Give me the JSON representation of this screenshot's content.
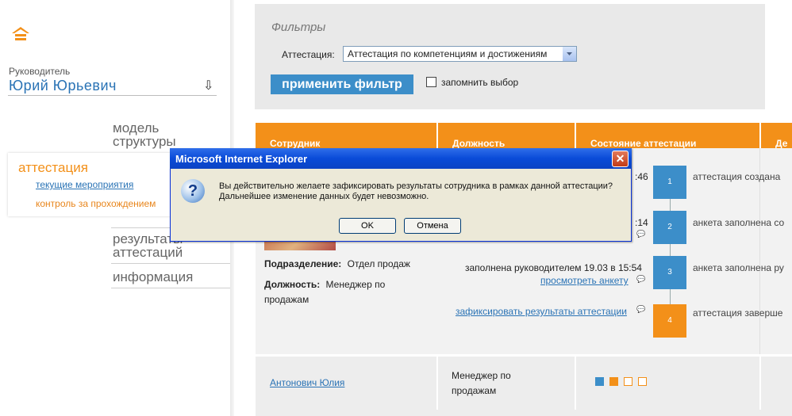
{
  "sidebar": {
    "role": "Руководитель",
    "user": "Юрий  Юрьевич",
    "nav": {
      "model_line1": "модель",
      "model_line2": "структуры",
      "attestation": "аттестация",
      "current_events": "текущие мероприятия",
      "progress_control": "контроль за прохождением",
      "results_line1": "результаты",
      "results_line2": "аттестаций",
      "info": "информация"
    }
  },
  "filters": {
    "title": "Фильтры",
    "attestation_label": "Аттестация:",
    "attestation_value": "Аттестация по компетенциям и достижениям",
    "apply_label": "применить фильтр",
    "remember_label": "запомнить выбор"
  },
  "table": {
    "headers": [
      "Сотрудник",
      "Должность",
      "Состояние аттестации",
      "Де"
    ],
    "row1": {
      "dept_label": "Подразделение:",
      "dept_value": "Отдел продаж",
      "position_label": "Должность:",
      "position_value_1": "Менеджер по",
      "position_value_2": "продажам",
      "time1": ":46",
      "time2": ":14",
      "filled_by_manager": "заполнена руководителем 19.03 в 15:54",
      "view_form": "просмотреть анкету",
      "fix_results": "зафиксировать результаты аттестации",
      "steps": [
        {
          "num": "1",
          "text": "аттестация создана"
        },
        {
          "num": "2",
          "text": "анкета заполнена со"
        },
        {
          "num": "3",
          "text": "анкета заполнена ру"
        },
        {
          "num": "4",
          "text": "аттестация заверше"
        }
      ]
    },
    "row2": {
      "employee": "Антонович Юлия",
      "position_1": "Менеджер по",
      "position_2": "продажам"
    }
  },
  "dialog": {
    "title": "Microsoft Internet Explorer",
    "close": "✕",
    "icon": "?",
    "message_1": "Вы действительно желаете зафиксировать результаты сотрудника в рамках данной аттестации?",
    "message_2": "Дальнейшее изменение данных будет невозможно.",
    "ok": "OK",
    "cancel": "Отмена"
  },
  "colors": {
    "accent_orange": "#f39019",
    "accent_blue": "#3c8ec9",
    "link_blue": "#2a73b5"
  }
}
